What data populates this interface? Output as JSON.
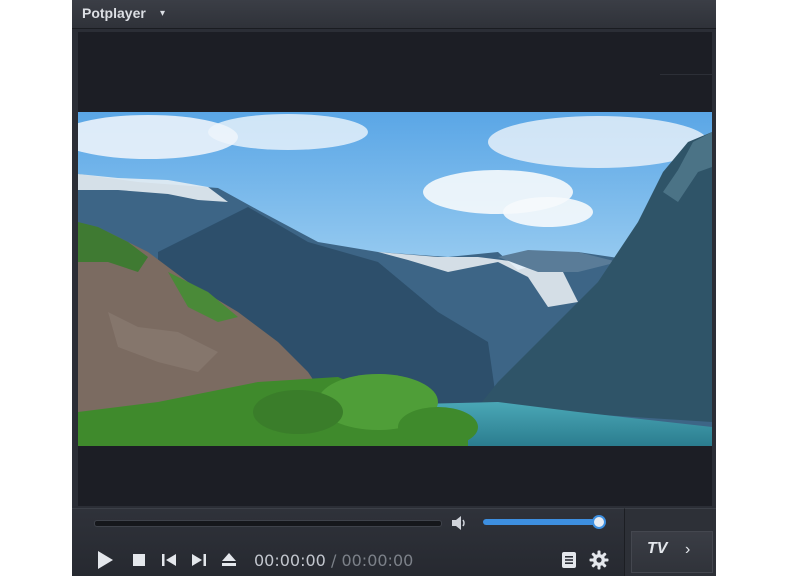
{
  "app": {
    "title": "Potplayer",
    "menu_caret": "▾"
  },
  "playback": {
    "position": "00:00:00",
    "separator": "/",
    "duration": "00:00:00",
    "seek_fraction": 0.0
  },
  "volume": {
    "level_fraction": 1.0
  },
  "side_panel": {
    "label": "TV",
    "arrow": "›"
  },
  "icons": {
    "play": "play-icon",
    "stop": "stop-icon",
    "previous": "skip-previous-icon",
    "next": "skip-next-icon",
    "eject": "eject-icon",
    "volume": "speaker-icon",
    "playlist": "playlist-icon",
    "settings": "gear-icon"
  },
  "colors": {
    "accent": "#3d8fe0",
    "chrome": "#2b2e36",
    "screen": "#1c1e25"
  }
}
